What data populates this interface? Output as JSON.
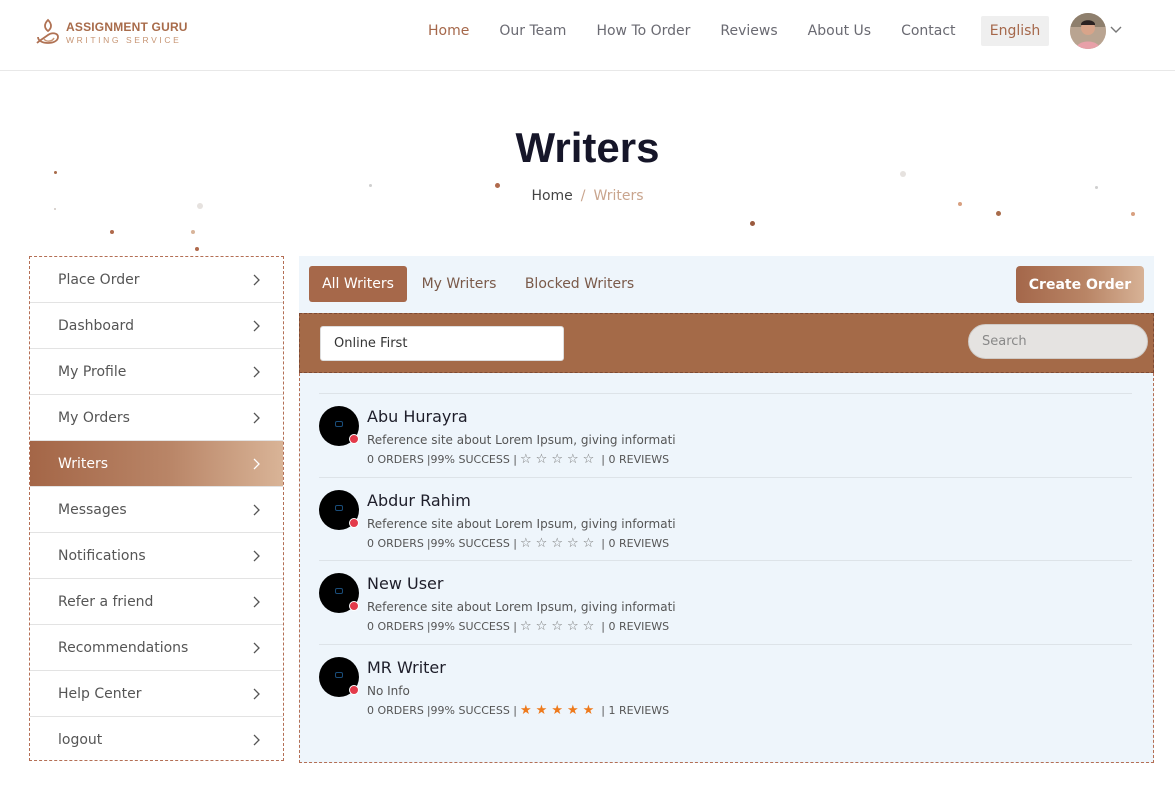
{
  "brand": {
    "name": "ASSIGNMENT GURU",
    "tagline": "WRITING SERVICE"
  },
  "nav": {
    "items": [
      {
        "label": "Home",
        "active": true
      },
      {
        "label": "Our Team"
      },
      {
        "label": "How To Order"
      },
      {
        "label": "Reviews"
      },
      {
        "label": "About Us"
      },
      {
        "label": "Contact"
      }
    ],
    "language": "English"
  },
  "hero": {
    "title": "Writers",
    "breadcrumb": {
      "home": "Home",
      "separator": "/",
      "current": "Writers"
    }
  },
  "sidebar": {
    "items": [
      {
        "label": "Place Order"
      },
      {
        "label": "Dashboard"
      },
      {
        "label": "My Profile"
      },
      {
        "label": "My Orders"
      },
      {
        "label": "Writers",
        "active": true
      },
      {
        "label": "Messages"
      },
      {
        "label": "Notifications"
      },
      {
        "label": "Refer a friend"
      },
      {
        "label": "Recommendations"
      },
      {
        "label": "Help Center"
      },
      {
        "label": "logout"
      }
    ]
  },
  "tabs": [
    {
      "label": "All Writers",
      "active": true
    },
    {
      "label": "My Writers"
    },
    {
      "label": "Blocked Writers"
    }
  ],
  "create_order_label": "Create Order",
  "filter": {
    "selected": "Online First",
    "search_placeholder": "Search"
  },
  "writers": [
    {
      "name": "Abu Hurayra",
      "description": "Reference site about Lorem Ipsum, giving informati",
      "orders": "0 ORDERS",
      "success": "|99% SUCCESS |",
      "rating": 0,
      "reviews": "| 0 REVIEWS",
      "status": "offline"
    },
    {
      "name": "Abdur Rahim",
      "description": "Reference site about Lorem Ipsum, giving informati",
      "orders": "0 ORDERS",
      "success": "|99% SUCCESS |",
      "rating": 0,
      "reviews": "| 0 REVIEWS",
      "status": "offline"
    },
    {
      "name": "New User",
      "description": "Reference site about Lorem Ipsum, giving informati",
      "orders": "0 ORDERS",
      "success": "|99% SUCCESS |",
      "rating": 0,
      "reviews": "| 0 REVIEWS",
      "status": "offline"
    },
    {
      "name": "MR Writer",
      "description": "No Info",
      "orders": "0 ORDERS",
      "success": "|99% SUCCESS |",
      "rating": 5,
      "reviews": "| 1 REVIEWS",
      "status": "offline"
    }
  ],
  "icons": {
    "chevron": "chevron-right-icon",
    "user_menu": "chevron-down-icon",
    "star_filled": "star-filled-icon",
    "star_empty": "star-empty-icon"
  },
  "colors": {
    "accent": "#a5674a",
    "accent_light": "#d7b296",
    "panel_bg": "#eef5fb",
    "star": "#ee7a1c",
    "status_offline": "#e33a4a",
    "title": "#161629"
  }
}
